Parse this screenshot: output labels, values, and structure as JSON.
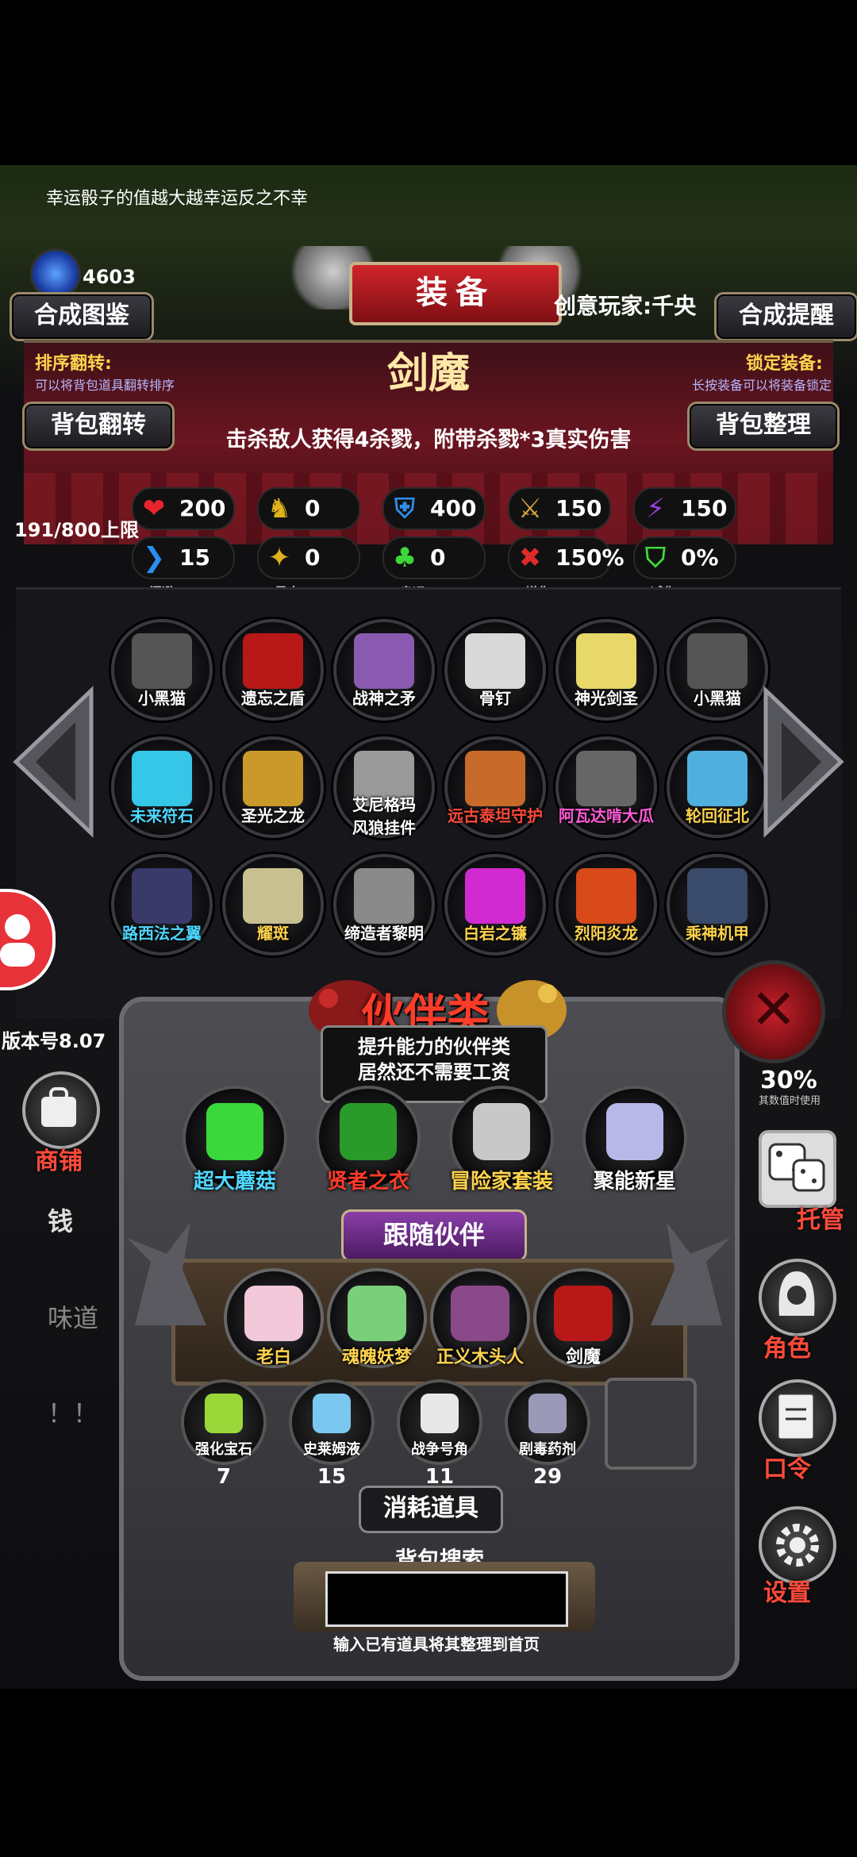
{
  "tip": "幸运骰子的值越大越幸运反之不幸",
  "gems": "4603",
  "buttons": {
    "synth_guide": "合成图鉴",
    "synth_remind": "合成提醒",
    "bag_flip": "背包翻转",
    "bag_sort": "背包整理"
  },
  "banner": "装备",
  "player": "创意玩家:千央",
  "left_info": {
    "title": "排序翻转:",
    "desc": "可以将背包道具翻转排序"
  },
  "right_info": {
    "title": "锁定装备:",
    "desc": "长按装备可以将装备锁定"
  },
  "item": {
    "name": "剑魔",
    "desc": "击杀敌人获得4杀戮，附带杀戮*3真实伤害"
  },
  "stats_row1": [
    {
      "icon": "❤",
      "color": "#e8242c",
      "value": "200"
    },
    {
      "icon": "♞",
      "color": "#e0b21c",
      "value": "0"
    },
    {
      "icon": "⛨",
      "color": "#2e8ee8",
      "value": "400"
    },
    {
      "icon": "⚔",
      "color": "#d8a640",
      "value": "150"
    },
    {
      "icon": "⚡",
      "color": "#9b3ee0",
      "value": "150"
    }
  ],
  "stats_row2": [
    {
      "icon": "❯",
      "color": "#2a8ef0",
      "value": "15",
      "sub": "闪避"
    },
    {
      "icon": "✦",
      "color": "#e0b21c",
      "value": "0",
      "sub": "暴击"
    },
    {
      "icon": "♣",
      "color": "#3ed83a",
      "value": "0",
      "sub": "幸运"
    },
    {
      "icon": "✖",
      "color": "#e02a2a",
      "value": "150%",
      "sub": "增伤"
    },
    {
      "icon": "⛉",
      "color": "#3ed83a",
      "value": "0%",
      "sub": "减伤"
    }
  ],
  "bag_limit": "191/800上限",
  "version": "版本号8.07",
  "equip_grid": [
    [
      {
        "name": "小黑猫",
        "color": "#fff",
        "art": "#555"
      },
      {
        "name": "遗忘之盾",
        "color": "#fff",
        "art": "#b81818"
      },
      {
        "name": "战神之矛",
        "color": "#fff",
        "art": "#8a5ab0"
      },
      {
        "name": "骨钉",
        "color": "#fff",
        "art": "#d9d9d9"
      },
      {
        "name": "神光剑圣",
        "color": "#fff",
        "art": "#e8d86a"
      },
      {
        "name": "小黑猫",
        "color": "#fff",
        "art": "#555"
      }
    ],
    [
      {
        "name": "未来符石",
        "color": "#4fd7ff",
        "art": "#35c6e8"
      },
      {
        "name": "圣光之龙",
        "color": "#fff",
        "art": "#c99a2a"
      },
      {
        "name": "艾尼格玛\n风狼挂件",
        "color": "#fff",
        "art": "#9a9a9a"
      },
      {
        "name": "远古泰坦守护",
        "color": "#ff4a3a",
        "art": "#c86a2a"
      },
      {
        "name": "阿瓦达啃大瓜",
        "color": "#ff5ad8",
        "art": "#666"
      },
      {
        "name": "轮回征北",
        "color": "#ffd34d",
        "art": "#4fb0e0"
      }
    ],
    [
      {
        "name": "路西法之翼",
        "color": "#4fd7ff",
        "art": "#3a3a6a"
      },
      {
        "name": "耀斑",
        "color": "#ffd34d",
        "art": "#c8c090"
      },
      {
        "name": "缔造者黎明",
        "color": "#fff",
        "art": "#8a8a8a"
      },
      {
        "name": "白岩之镰",
        "color": "#ffd34d",
        "art": "#d02ad0"
      },
      {
        "name": "烈阳炎龙",
        "color": "#ffd34d",
        "art": "#d84a1a"
      },
      {
        "name": "乘神机甲",
        "color": "#ffd34d",
        "art": "#3a4a6a"
      }
    ]
  ],
  "companion": {
    "title": "伙伴类",
    "desc1": "提升能力的伙伴类",
    "desc2": "居然还不需要工资",
    "items": [
      {
        "name": "超大蘑菇",
        "color": "#4fd7ff",
        "art": "#3ad83a"
      },
      {
        "name": "贤者之衣",
        "color": "#ff3b2a",
        "art": "#2a9a2a"
      },
      {
        "name": "冒险家套装",
        "color": "#ffd34d",
        "art": "#c8c8c8"
      },
      {
        "name": "聚能新星",
        "color": "#fff",
        "art": "#b8b8e8"
      }
    ]
  },
  "follow": {
    "title": "跟随伙伴",
    "items": [
      {
        "name": "老白",
        "color": "#ffd34d",
        "art": "#f3c8d8"
      },
      {
        "name": "魂魄妖梦",
        "color": "#ffd34d",
        "art": "#7acf7a"
      },
      {
        "name": "正义木头人",
        "color": "#ffd34d",
        "art": "#8a4a8a"
      },
      {
        "name": "剑魔",
        "color": "#fff",
        "art": "#b81818"
      }
    ]
  },
  "consumables": {
    "title": "消耗道具",
    "items": [
      {
        "name": "强化宝石",
        "count": "7",
        "art": "#9ad83a"
      },
      {
        "name": "史莱姆液",
        "count": "15",
        "art": "#7ac8f0"
      },
      {
        "name": "战争号角",
        "count": "11",
        "art": "#e8e8e8"
      },
      {
        "name": "剧毒药剂",
        "count": "29",
        "art": "#9a9ab8"
      }
    ]
  },
  "search": {
    "title": "背包搜索",
    "hint": "输入已有道具将其整理到首页"
  },
  "side": {
    "shop": "商铺",
    "manage": "托管",
    "role": "角色",
    "code": "口令",
    "settings": "设置"
  },
  "behind": {
    "money": "钱",
    "taste": "味道",
    "bang": "！！",
    "pct": "30%",
    "pct_hint": "其数值时使用"
  }
}
